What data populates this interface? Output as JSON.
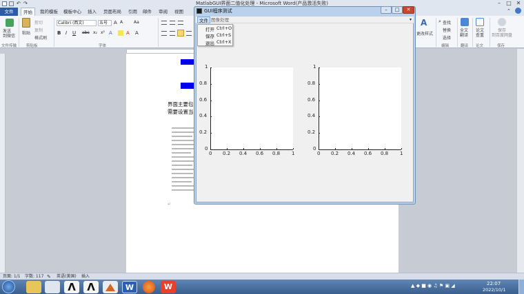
{
  "word": {
    "title": "MatlabGUI界面二值化处理 - Microsoft Word(产品激活失败)",
    "tabs": [
      "文件",
      "开始",
      "我的模板",
      "模板中心",
      "插入",
      "页面布局",
      "引用",
      "邮件",
      "审阅",
      "视图"
    ],
    "clipboard": {
      "paste": "粘贴",
      "cut": "剪切",
      "copy": "复制",
      "format_painter": "格式刷",
      "group": "剪贴板"
    },
    "send": {
      "label": "发送\n到微信",
      "group": "文件传输"
    },
    "font": {
      "name": "Calibri (西文)",
      "size": "五号",
      "group": "字体"
    },
    "right_groups": {
      "style": "更改样式",
      "find": "查找",
      "replace": "替换",
      "select": "选择",
      "edit_group": "编辑",
      "translate": "全文\n翻译",
      "translate_group": "翻译",
      "paper": "论文\n查重",
      "paper_group": "论文",
      "save_web": "保存\n到百度网盘",
      "save_group": "保存"
    },
    "doc_text": {
      "line1": "界面主要包",
      "line2": "需要设置当"
    },
    "status": {
      "page": "页面: 1/1",
      "words": "字数: 117",
      "lang": "英语(美国)",
      "insert": "插入"
    },
    "clock": {
      "time": "22:07",
      "date": "2022/10/1"
    }
  },
  "gui": {
    "title": "GUI程序测试",
    "menus": [
      "文件",
      "图像处理"
    ],
    "dropdown": [
      {
        "label": "打开",
        "shortcut": "Ctrl+O"
      },
      {
        "label": "保存",
        "shortcut": "Ctrl+S"
      },
      {
        "label": "退出",
        "shortcut": "Ctrl+X"
      }
    ]
  },
  "chart_data": [
    {
      "type": "line",
      "x_ticks": [
        "0",
        "0.2",
        "0.4",
        "0.6",
        "0.8",
        "1"
      ],
      "y_ticks": [
        "0",
        "0.2",
        "0.4",
        "0.6",
        "0.8",
        "1"
      ],
      "xlim": [
        0,
        1
      ],
      "ylim": [
        0,
        1
      ],
      "series": []
    },
    {
      "type": "line",
      "x_ticks": [
        "0",
        "0.2",
        "0.4",
        "0.6",
        "0.8",
        "1"
      ],
      "y_ticks": [
        "0",
        "0.2",
        "0.4",
        "0.6",
        "0.8",
        "1"
      ],
      "xlim": [
        0,
        1
      ],
      "ylim": [
        0,
        1
      ],
      "series": []
    }
  ],
  "colors": {
    "file_tab": "#2a5caa",
    "taskbar": "#3a5f8f",
    "gui_frame": "#b9d1ea",
    "doc_blue": "#0000ee"
  }
}
